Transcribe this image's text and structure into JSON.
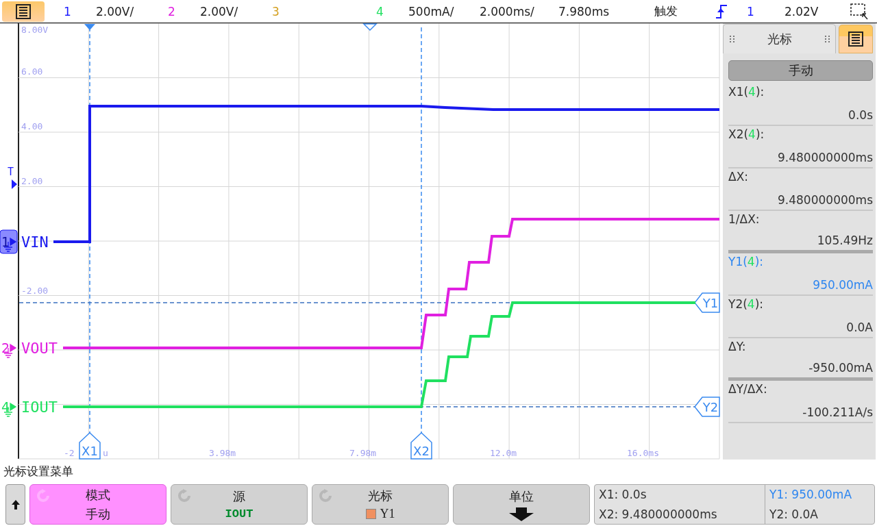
{
  "top_bar": {
    "channels": [
      {
        "number": "1",
        "scale": "2.00V/",
        "color": "#1a1aff"
      },
      {
        "number": "2",
        "scale": "2.00V/",
        "color": "#e020e0"
      },
      {
        "number": "3",
        "color": "#d4a020"
      },
      {
        "number": "4",
        "scale": "500mA/",
        "color": "#20e060"
      }
    ],
    "timebase": "2.000ms/",
    "delay": "7.980ms",
    "trigger": {
      "label": "触发",
      "source": "1",
      "level": "2.02V"
    }
  },
  "scope": {
    "y_labels": [
      "8.00V",
      "6.00",
      "4.00",
      "2.00",
      "-2.00"
    ],
    "x_labels": [
      "-2",
      "u",
      "3.98m",
      "7.98m",
      "12.0m",
      "16.0ms"
    ],
    "trigger_marker": "T",
    "traces": [
      {
        "number": "1",
        "label": "VIN",
        "color": "#1a1aee",
        "selected": true
      },
      {
        "number": "2",
        "label": "VOUT",
        "color": "#e020e0",
        "selected": false
      },
      {
        "number": "4",
        "label": "IOUT",
        "color": "#20e060",
        "selected": false
      }
    ],
    "cursors": [
      {
        "label": "X1",
        "kind": "x"
      },
      {
        "label": "X2",
        "kind": "x"
      },
      {
        "label": "Y1",
        "kind": "y"
      },
      {
        "label": "Y2",
        "kind": "y"
      }
    ]
  },
  "cursor_panel": {
    "tab": "光标",
    "mode": "手动",
    "rows": [
      {
        "label": "X1(",
        "source": "4",
        "label_end": "):",
        "value": "0.0s",
        "selected": false,
        "thick_rule": false
      },
      {
        "label": "X2(",
        "source": "4",
        "label_end": "):",
        "value": "9.480000000ms",
        "selected": false,
        "thick_rule": false
      },
      {
        "label": "ΔX:",
        "value": "9.480000000ms",
        "selected": false,
        "thick_rule": false
      },
      {
        "label": "1/ΔX:",
        "value": "105.49Hz",
        "selected": false,
        "thick_rule": true
      },
      {
        "label": "Y1(",
        "source": "4",
        "label_end": "):",
        "value": "950.00mA",
        "selected": true,
        "thick_rule": false
      },
      {
        "label": "Y2(",
        "source": "4",
        "label_end": "):",
        "value": "0.0A",
        "selected": false,
        "thick_rule": false
      },
      {
        "label": "ΔY:",
        "value": "-950.00mA",
        "selected": false,
        "thick_rule": true
      },
      {
        "label": "ΔY/ΔX:",
        "value": "-100.211A/s",
        "selected": false,
        "thick_rule": false
      }
    ]
  },
  "menu_title": "光标设置菜单",
  "softkeys": [
    {
      "kind": "text",
      "label": "模式",
      "value": "手动",
      "selected": true
    },
    {
      "kind": "source",
      "label": "源",
      "value": "IOUT",
      "selected": false
    },
    {
      "kind": "swatch",
      "label": "光标",
      "value": "Y1",
      "selected": false
    },
    {
      "kind": "arrow",
      "label": "单位",
      "selected": false
    }
  ],
  "readout": [
    [
      {
        "text": "X1: 0.0s",
        "selected": false
      },
      {
        "text": "X2: 9.480000000ms",
        "selected": false
      }
    ],
    [
      {
        "text": "Y1: 950.00mA",
        "selected": true
      },
      {
        "text": "Y2: 0.0A",
        "selected": false
      }
    ]
  ]
}
